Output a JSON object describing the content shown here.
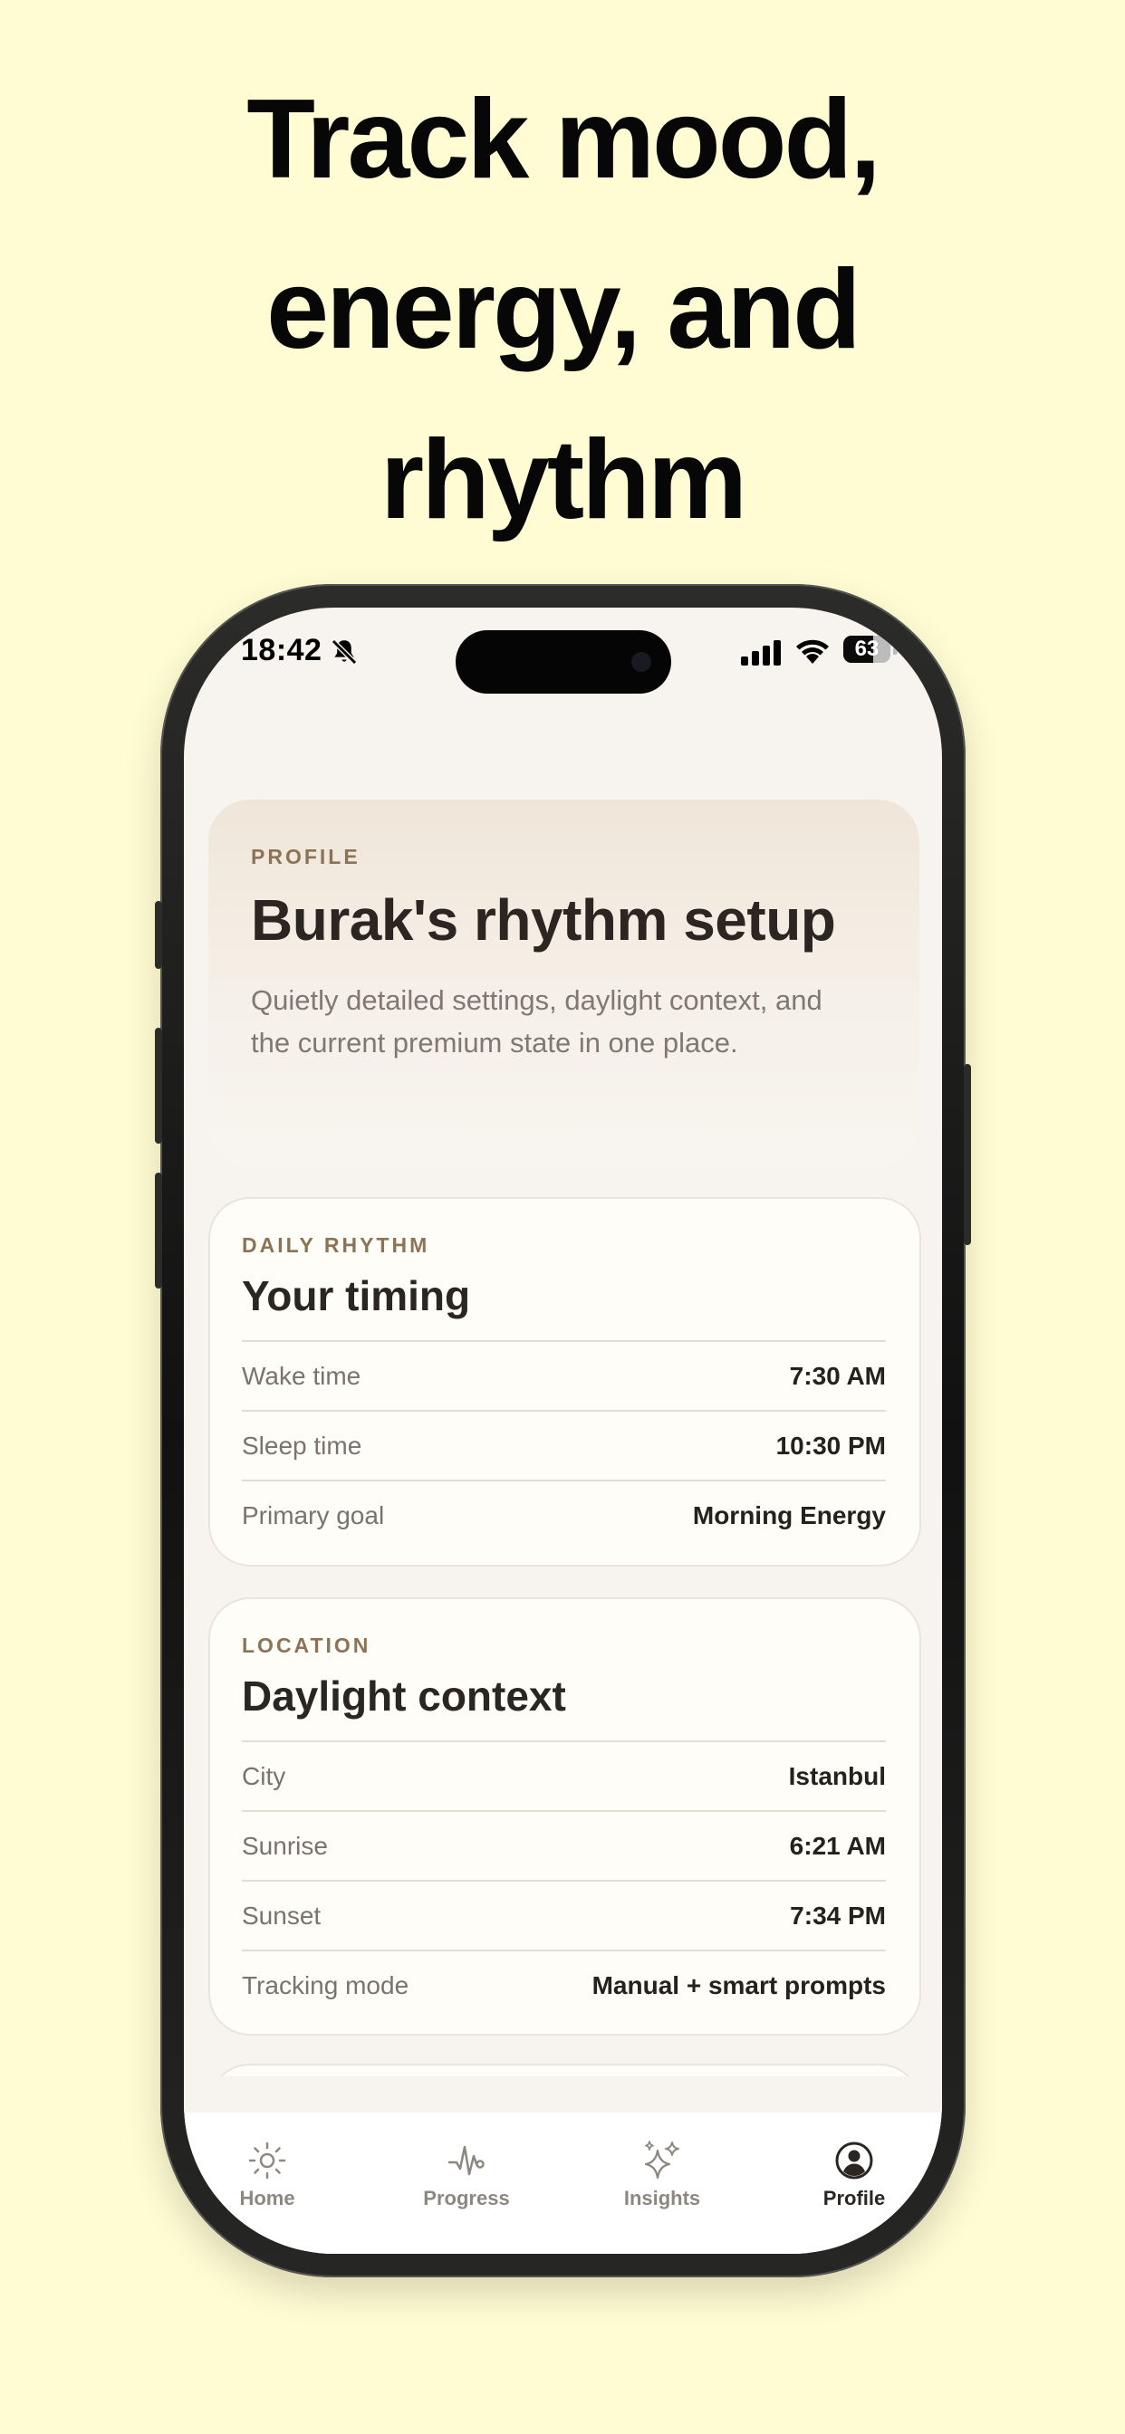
{
  "headline": {
    "line1": "Track mood,",
    "line2": "energy, and",
    "line3": "rhythm"
  },
  "status_bar": {
    "time": "18:42",
    "battery_percent": 63,
    "battery_label": "63",
    "icons": [
      "bell-slash-icon",
      "cellular-signal-icon",
      "wifi-icon",
      "battery-icon"
    ]
  },
  "profile": {
    "eyebrow": "PROFILE",
    "title": "Burak's rhythm setup",
    "description": "Quietly detailed settings, daylight context, and the current premium state in one place."
  },
  "daily_rhythm": {
    "eyebrow": "DAILY RHYTHM",
    "title": "Your timing",
    "rows": [
      {
        "label": "Wake time",
        "value": "7:30 AM"
      },
      {
        "label": "Sleep time",
        "value": "10:30 PM"
      },
      {
        "label": "Primary goal",
        "value": "Morning Energy"
      }
    ]
  },
  "location": {
    "eyebrow": "LOCATION",
    "title": "Daylight context",
    "rows": [
      {
        "label": "City",
        "value": "Istanbul"
      },
      {
        "label": "Sunrise",
        "value": "6:21 AM"
      },
      {
        "label": "Sunset",
        "value": "7:34 PM"
      },
      {
        "label": "Tracking mode",
        "value": "Manual + smart prompts"
      }
    ]
  },
  "tabbar": {
    "active": "Profile",
    "tabs": [
      {
        "label": "Home",
        "icon": "sun-icon"
      },
      {
        "label": "Progress",
        "icon": "pulse-icon"
      },
      {
        "label": "Insights",
        "icon": "sparkles-icon"
      },
      {
        "label": "Profile",
        "icon": "person-circle-icon"
      }
    ]
  },
  "colors": {
    "background": "#fffbd2",
    "accent": "#8d7356",
    "text": "#2b2622",
    "muted": "#7b736b"
  }
}
